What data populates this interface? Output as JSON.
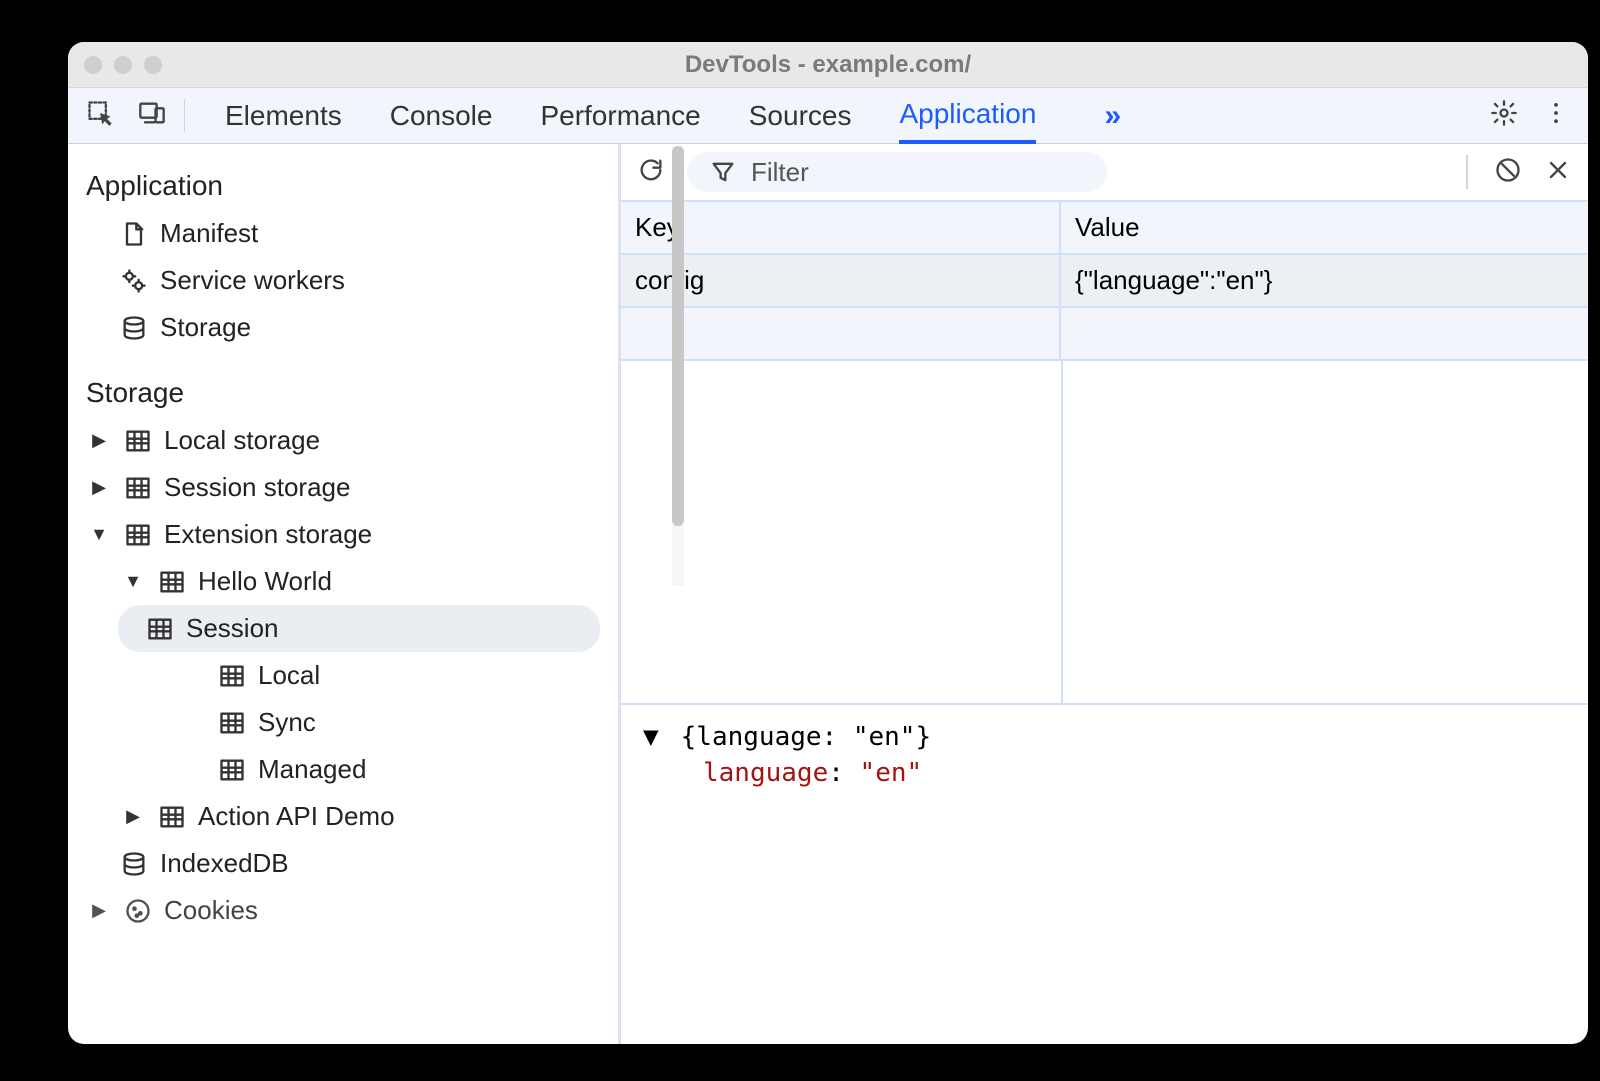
{
  "window": {
    "title": "DevTools - example.com/"
  },
  "tabs": {
    "items": [
      "Elements",
      "Console",
      "Performance",
      "Sources",
      "Application"
    ],
    "active": "Application"
  },
  "sidebar": {
    "sections": {
      "application": {
        "title": "Application",
        "items": [
          {
            "label": "Manifest"
          },
          {
            "label": "Service workers"
          },
          {
            "label": "Storage"
          }
        ]
      },
      "storage": {
        "title": "Storage",
        "items": [
          {
            "label": "Local storage"
          },
          {
            "label": "Session storage"
          },
          {
            "label": "Extension storage"
          },
          {
            "label": "Hello World"
          },
          {
            "label": "Session"
          },
          {
            "label": "Local"
          },
          {
            "label": "Sync"
          },
          {
            "label": "Managed"
          },
          {
            "label": "Action API Demo"
          },
          {
            "label": "IndexedDB"
          },
          {
            "label": "Cookies"
          }
        ]
      }
    }
  },
  "toolbar": {
    "filter_placeholder": "Filter"
  },
  "table": {
    "headers": {
      "key": "Key",
      "value": "Value"
    },
    "rows": [
      {
        "key": "config",
        "value": "{\"language\":\"en\"}"
      }
    ]
  },
  "viewer": {
    "summary": "{language: \"en\"}",
    "key": "language",
    "value": "\"en\""
  }
}
